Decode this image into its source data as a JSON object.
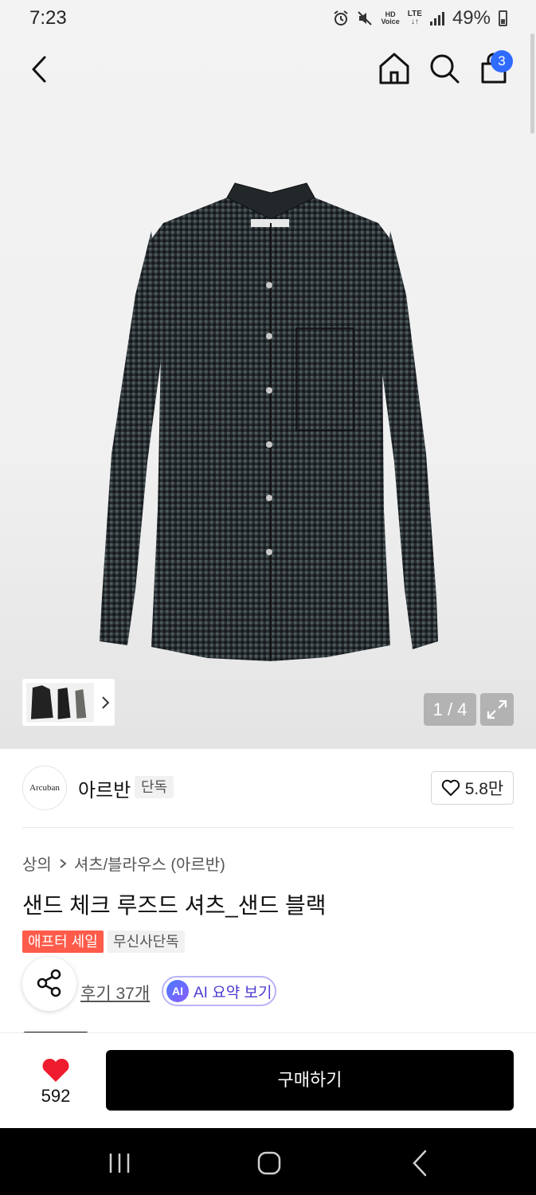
{
  "status_bar": {
    "time": "7:23",
    "hd_label": "HD",
    "voice_label": "Voice",
    "lte_label": "LTE",
    "battery": "49%"
  },
  "nav": {
    "back_icon": "chevron-left-icon",
    "home_icon": "home-icon",
    "search_icon": "search-icon",
    "cart_icon": "shopping-bag-icon",
    "cart_count": "3",
    "cart_badge_color": "#2f6bff"
  },
  "gallery": {
    "counter": "1 / 4",
    "expand_icon": "expand-icon",
    "thumbnail_arrow_icon": "chevron-right-icon"
  },
  "brand": {
    "logo_text": "Arcuban",
    "name": "아르반",
    "tag": "단독",
    "likes": "5.8만"
  },
  "breadcrumb": {
    "items": [
      "상의",
      "셔츠/블라우스 (아르반)"
    ]
  },
  "product": {
    "title": "샌드 체크 루즈드 셔츠_샌드 블랙",
    "tags": [
      "애프터 세일",
      "무신사단독"
    ],
    "sale_tag_color": "#ff5b4a",
    "reviews": "후기 37개",
    "ai_badge": "AI",
    "ai_summary": "AI 요약 보기"
  },
  "purchase_bar": {
    "heart_count": "592",
    "heart_color": "#ee1c2e",
    "buy_label": "구매하기"
  }
}
